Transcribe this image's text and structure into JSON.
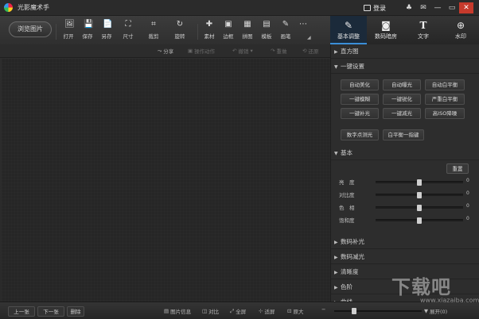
{
  "app": {
    "title": "光影魔术手",
    "login_label": "登录"
  },
  "window_controls": [
    "♣",
    "✉",
    "—",
    "▭",
    "✕"
  ],
  "toolbar": {
    "browse_label": "浏览图片",
    "tools": [
      {
        "label": "打开",
        "icon": "🖼"
      },
      {
        "label": "保存",
        "icon": "💾"
      },
      {
        "label": "另存",
        "icon": "📄"
      },
      {
        "label": "尺寸",
        "icon": "⛶"
      },
      {
        "label": "裁剪",
        "icon": "⌗"
      },
      {
        "label": "旋转",
        "icon": "↻"
      },
      {
        "label": "素材",
        "icon": "✚"
      },
      {
        "label": "边框",
        "icon": "▣"
      },
      {
        "label": "拼图",
        "icon": "▦"
      },
      {
        "label": "模板",
        "icon": "▤"
      },
      {
        "label": "画笔",
        "icon": "✎"
      },
      {
        "label": "…",
        "icon": "⋯"
      }
    ]
  },
  "right_tabs": [
    {
      "label": "基本调整",
      "icon": "✎"
    },
    {
      "label": "数码暗房",
      "icon": "◙"
    },
    {
      "label": "文字",
      "icon": "T"
    },
    {
      "label": "水印",
      "icon": "⊕"
    }
  ],
  "subbar": {
    "share": "分享",
    "ops": "操作动作",
    "undo": "撤销",
    "redo": "重做",
    "restore": "还原"
  },
  "panel": {
    "histogram": "直方图",
    "one_click": "一键设置",
    "one_click_buttons": [
      "自动美化",
      "自动曝光",
      "自动白平衡",
      "一键模糊",
      "一键锐化",
      "严重白平衡",
      "一键补光",
      "一键减光",
      "高ISO降噪"
    ],
    "extra_buttons": [
      "数字点测光",
      "白平衡一指键"
    ],
    "basic": "基本",
    "reset": "重置",
    "sliders": [
      {
        "label": "亮　度",
        "value": 0,
        "pos": 0.5
      },
      {
        "label": "对比度",
        "value": 0,
        "pos": 0.5
      },
      {
        "label": "色　相",
        "value": 0,
        "pos": 0.5
      },
      {
        "label": "饱和度",
        "value": 0,
        "pos": 0.5
      }
    ],
    "collapsed_sections": [
      "数码补光",
      "数码减光",
      "清晰度",
      "色阶",
      "曲线"
    ]
  },
  "bottom": {
    "prev": "上一张",
    "next": "下一张",
    "delete": "删除",
    "info": "图片信息",
    "compare": "对比",
    "fullscreen": "全屏",
    "fit": "适屏",
    "original": "原大",
    "zoom_pos": 0.2,
    "expand": "展开(0)"
  },
  "watermark": {
    "main": "下载吧",
    "sub": "www.xiazaiba.com"
  }
}
